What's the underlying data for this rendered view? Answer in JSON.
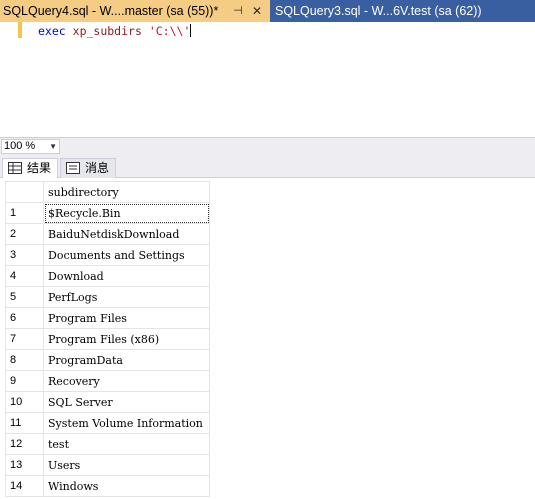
{
  "tabs": {
    "active": {
      "title": "SQLQuery4.sql - W....master (sa (55))*",
      "pin": "⊣",
      "close": "✕"
    },
    "inactive": {
      "title": "SQLQuery3.sql - W...6V.test (sa (62))"
    }
  },
  "editor": {
    "keyword": "exec",
    "proc": "xp_subdirs",
    "argument": "'C:\\\\'"
  },
  "zoom": {
    "value": "100 %"
  },
  "results_tabs": {
    "results": "结果",
    "messages": "消息"
  },
  "grid": {
    "column_header": "subdirectory",
    "rows": [
      {
        "n": "1",
        "v": "$Recycle.Bin"
      },
      {
        "n": "2",
        "v": "BaiduNetdiskDownload"
      },
      {
        "n": "3",
        "v": "Documents and Settings"
      },
      {
        "n": "4",
        "v": "Download"
      },
      {
        "n": "5",
        "v": "PerfLogs"
      },
      {
        "n": "6",
        "v": "Program Files"
      },
      {
        "n": "7",
        "v": "Program Files (x86)"
      },
      {
        "n": "8",
        "v": "ProgramData"
      },
      {
        "n": "9",
        "v": "Recovery"
      },
      {
        "n": "10",
        "v": "SQL Server"
      },
      {
        "n": "11",
        "v": "System Volume Information"
      },
      {
        "n": "12",
        "v": "test"
      },
      {
        "n": "13",
        "v": "Users"
      },
      {
        "n": "14",
        "v": "Windows"
      }
    ]
  },
  "colors": {
    "tab_active": "#f5cc84",
    "tab_strip": "#3a5fa0",
    "keyword": "#0000ff",
    "string": "#c0182a"
  }
}
